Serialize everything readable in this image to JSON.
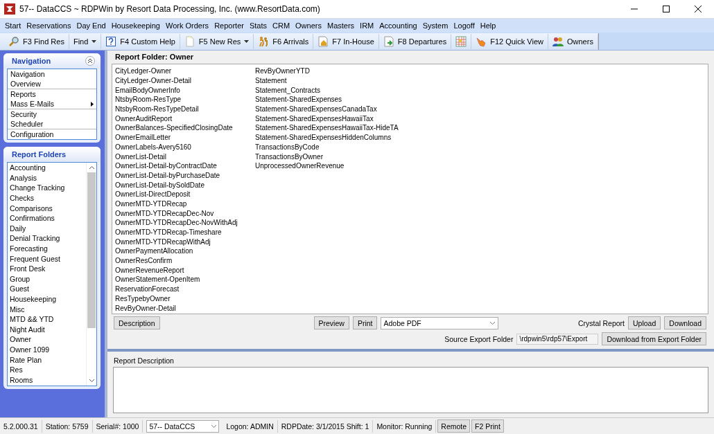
{
  "window": {
    "title": "57-- DataCCS ~ RDPWin by Resort Data Processing, Inc. (www.ResortData.com)"
  },
  "menu": [
    "Start",
    "Reservations",
    "Day End",
    "Housekeeping",
    "Work Orders",
    "Reporter",
    "Stats",
    "CRM",
    "Owners",
    "Masters",
    "IRM",
    "Accounting",
    "System",
    "Logoff",
    "Help"
  ],
  "toolbar": [
    {
      "label": "F3 Find Res",
      "dropdown": false
    },
    {
      "label": "Find",
      "dropdown": true
    },
    {
      "label": "F4 Custom Help",
      "dropdown": false
    },
    {
      "label": "F5 New Res",
      "dropdown": true
    },
    {
      "label": "F6 Arrivals",
      "dropdown": false
    },
    {
      "label": "F7 In-House",
      "dropdown": false
    },
    {
      "label": "F8 Departures",
      "dropdown": false
    },
    {
      "dropdown": false
    },
    {
      "label": "F12 Quick View",
      "dropdown": false
    },
    {
      "label": "Owners",
      "dropdown": false
    }
  ],
  "navigation": {
    "title": "Navigation",
    "groups": [
      [
        {
          "label": "Navigation",
          "submenu": false
        },
        {
          "label": "Overview",
          "submenu": false
        }
      ],
      [
        {
          "label": "Reports",
          "submenu": false
        },
        {
          "label": "Mass E-Mails",
          "submenu": true
        }
      ],
      [
        {
          "label": "Security",
          "submenu": false
        },
        {
          "label": "Scheduler",
          "submenu": false
        }
      ],
      [
        {
          "label": "Configuration",
          "submenu": false
        }
      ]
    ]
  },
  "report_folders": {
    "title": "Report Folders",
    "items": [
      "Accounting",
      "Analysis",
      "Change Tracking",
      "Checks",
      "Comparisons",
      "Confirmations",
      "Daily",
      "Denial Tracking",
      "Forecasting",
      "Frequent Guest",
      "Front Desk",
      "Group",
      "Guest",
      "Housekeeping",
      "Misc",
      "MTD && YTD",
      "Night Audit",
      "Owner",
      "Owner 1099",
      "Rate Plan",
      "Res",
      "Rooms"
    ]
  },
  "report_folder": {
    "title": "Report Folder: Owner",
    "columns": [
      [
        "CityLedger-Owner",
        "CityLedger-Owner-Detail",
        "EmailBodyOwnerInfo",
        "NtsbyRoom-ResType",
        "NtsbyRoom-ResTypeDetail",
        "OwnerAuditReport",
        "OwnerBalances-SpecifiedClosingDate",
        "OwnerEmailLetter",
        "OwnerLabels-Avery5160",
        "OwnerList-Detail",
        "OwnerList-Detail-byContractDate",
        "OwnerList-Detail-byPurchaseDate",
        "OwnerList-Detail-bySoldDate",
        "OwnerList-DirectDeposit",
        "OwnerMTD-YTDRecap",
        "OwnerMTD-YTDRecapDec-Nov",
        "OwnerMTD-YTDRecapDec-NovWithAdj",
        "OwnerMTD-YTDRecap-Timeshare",
        "OwnerMTD-YTDRecapWithAdj",
        "OwnerPaymentAllocation",
        "OwnerResConfirm",
        "OwnerRevenueReport",
        "OwnerStatement-OpenItem",
        "ReservationForecast",
        "ResTypebyOwner",
        "RevByOwner-Detail"
      ],
      [
        "RevByOwnerYTD",
        "Statement",
        "Statement_Contracts",
        "Statement-SharedExpenses",
        "Statement-SharedExpensesCanadaTax",
        "Statement-SharedExpensesHawaiiTax",
        "Statement-SharedExpensesHawaiiTax-HideTA",
        "Statement-SharedExpensesHiddenColumns",
        "TransactionsByCode",
        "TransactionsByOwner",
        "UnprocessedOwnerRevenue"
      ]
    ]
  },
  "actions": {
    "description": "Description",
    "preview": "Preview",
    "print": "Print",
    "format": "Adobe PDF",
    "crystal_label": "Crystal Report",
    "upload": "Upload",
    "download": "Download",
    "export_label": "Source Export Folder",
    "export_folder": "\\rdpwin5\\rdp57\\Export",
    "download_export": "Download from Export Folder"
  },
  "description": {
    "label": "Report Description"
  },
  "status_bar": {
    "version": "5.2.000.31",
    "station": "Station: 5759",
    "serial": "Serial#: 1000",
    "database": "57-- DataCCS",
    "logon": "Logon: ADMIN",
    "date": "RDPDate: 3/1/2015 Shift: 1",
    "monitor": "Monitor: Running",
    "buttons": [
      "Remote",
      "F2 Print"
    ]
  }
}
